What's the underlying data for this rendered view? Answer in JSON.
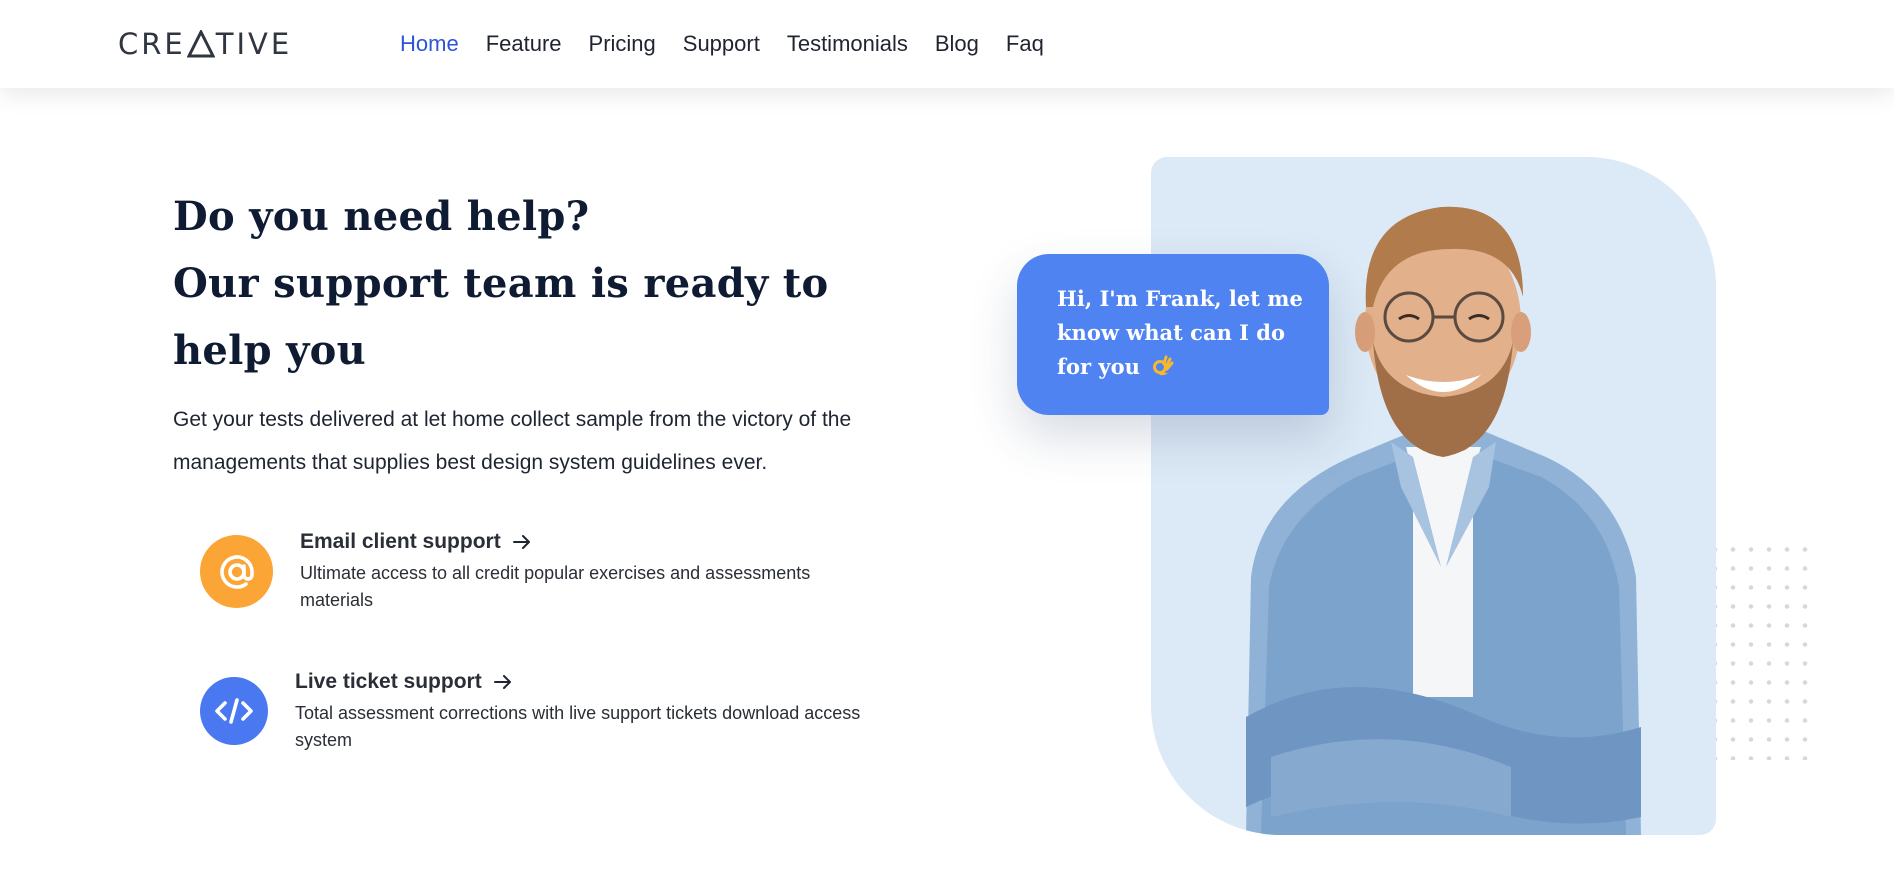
{
  "header": {
    "logo_text": "CREATIVE",
    "nav": [
      {
        "label": "Home",
        "active": true
      },
      {
        "label": "Feature",
        "active": false
      },
      {
        "label": "Pricing",
        "active": false
      },
      {
        "label": "Support",
        "active": false
      },
      {
        "label": "Testimonials",
        "active": false
      },
      {
        "label": "Blog",
        "active": false
      },
      {
        "label": "Faq",
        "active": false
      }
    ]
  },
  "hero": {
    "headline_line1": "Do you need help?",
    "headline_line2": "Our support team is ready to help you",
    "description": "Get your tests delivered at let home collect sample from the victory of the managements that supplies best design system guidelines ever.",
    "features": [
      {
        "title": "Email client support",
        "description": "Ultimate access to all credit popular exercises and assessments materials",
        "icon": "at-sign-icon",
        "color": "#fba536"
      },
      {
        "title": "Live ticket support",
        "description": "Total assessment corrections with live support tickets download access system",
        "icon": "code-icon",
        "color": "#4a78f0"
      }
    ],
    "chat_bubble": {
      "text": "Hi, I'm Frank, let me know what can I do for you",
      "emoji_icon": "ok-hand-icon",
      "color": "#4f83f1"
    }
  },
  "colors": {
    "accent": "#2d55d6",
    "heading": "#0f1b33",
    "photo_bg": "#dce9f6"
  }
}
